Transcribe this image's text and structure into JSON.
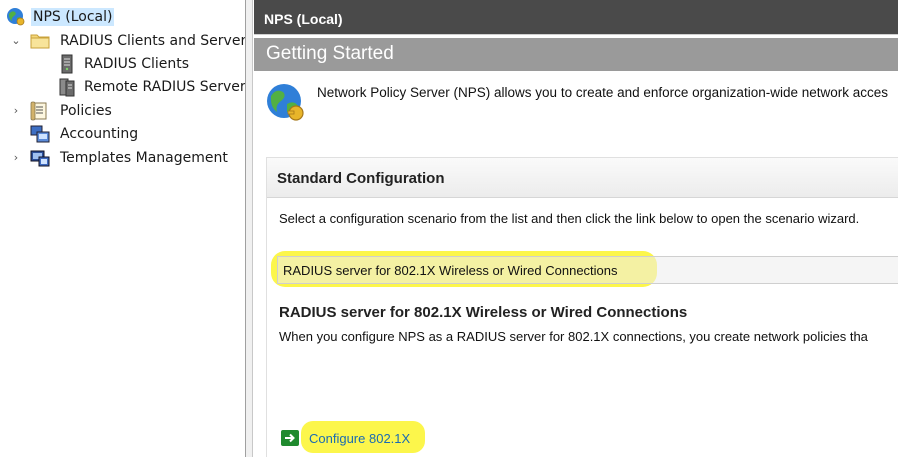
{
  "tree": {
    "root": {
      "label": "NPS (Local)",
      "icon": "nps-globe-icon"
    },
    "radius_clients_and_servers": {
      "label": "RADIUS Clients and Servers",
      "expanded": true,
      "icon": "folder-icon"
    },
    "radius_clients": {
      "label": "RADIUS Clients",
      "icon": "server-icon"
    },
    "remote_radius": {
      "label": "Remote RADIUS Server (",
      "icon": "server-group-icon"
    },
    "policies": {
      "label": "Policies",
      "icon": "policies-icon"
    },
    "accounting": {
      "label": "Accounting",
      "icon": "accounting-icon"
    },
    "templates": {
      "label": "Templates Management",
      "icon": "templates-icon"
    }
  },
  "content": {
    "header_title": "NPS (Local)",
    "banner_title": "Getting Started",
    "intro_text": "Network Policy Server (NPS) allows you to create and enforce organization-wide network acces",
    "standard_config": {
      "title": "Standard Configuration",
      "description": "Select a configuration scenario from the list and then click the link below to open the scenario wizard.",
      "selected_scenario": "RADIUS server for 802.1X Wireless or Wired Connections",
      "scenario_heading": "RADIUS server for 802.1X Wireless or Wired Connections",
      "scenario_description": "When you configure NPS as a RADIUS server for 802.1X connections, you create network policies tha",
      "configure_link": "Configure 802.1X"
    }
  },
  "colors": {
    "header_bg": "#4a4a4a",
    "banner_bg": "#9a9a9a",
    "selection_bg": "#cce8ff",
    "highlight": "#fbf52b",
    "link": "#1a6bb3",
    "configure_arrow": "#1f8a2e"
  }
}
